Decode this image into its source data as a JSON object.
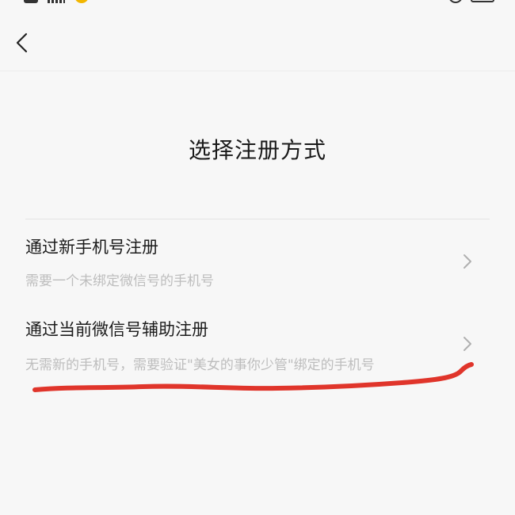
{
  "page": {
    "title": "选择注册方式"
  },
  "nav": {
    "back_icon": "chevron-left-icon"
  },
  "options": [
    {
      "title": "通过新手机号注册",
      "subtitle": "需要一个未绑定微信号的手机号",
      "icon": "chevron-right-icon"
    },
    {
      "title": "通过当前微信号辅助注册",
      "subtitle": "无需新的手机号，需要验证\"美女的事你少管\"绑定的手机号",
      "icon": "chevron-right-icon"
    }
  ],
  "colors": {
    "background": "#f7f7f7",
    "title_text": "#1a1a1a",
    "subtitle_text": "#bdbdbd",
    "chevron": "#b0b0b0",
    "annotation_stroke": "#e0352b"
  }
}
